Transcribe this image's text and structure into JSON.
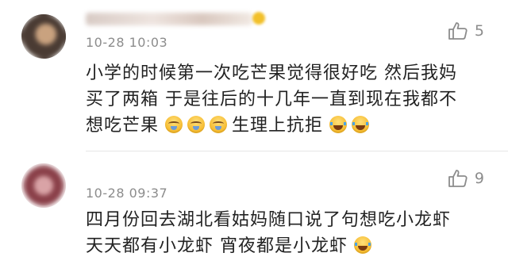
{
  "comments": [
    {
      "time": "10-28 10:03",
      "likes": "5",
      "lines": [
        "小学的时候第一次吃芒果觉得很好吃 然后我妈",
        "买了两箱 于是往后的十几年一直到现在我都不",
        "想吃芒果"
      ],
      "line3_suffix": "生理上抗拒"
    },
    {
      "time": "10-28 09:37",
      "likes": "9",
      "lines": [
        "四月份回去湖北看姑妈随口说了句想吃小龙虾",
        "天天都有小龙虾 宵夜都是小龙虾"
      ]
    }
  ],
  "icons": {
    "like": "thumbs-up-icon",
    "cry_emoji": "crying-face-emoji",
    "laugh_emoji": "laughing-tears-emoji"
  },
  "colors": {
    "text": "#222222",
    "meta": "#8c8c8c",
    "background": "#ffffff"
  }
}
